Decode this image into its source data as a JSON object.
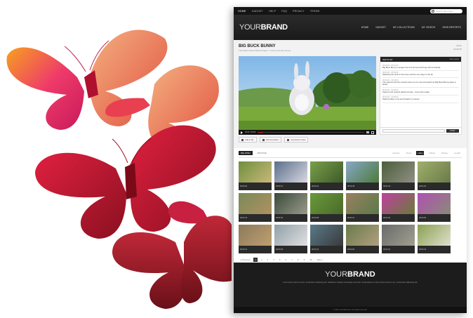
{
  "top_nav": {
    "items": [
      "HOME",
      "GADGET",
      "HELP",
      "FAQ",
      "PRIVACY",
      "TERMS"
    ],
    "search_placeholder": "Search video here"
  },
  "header": {
    "brand_main": "YOUR",
    "brand_bold": "BRAND",
    "nav": [
      "HOME",
      "GADGET",
      "MY COLLECTIONS",
      "MY VIDEOS",
      "VIEW REPORTS"
    ]
  },
  "video": {
    "title": "BIG BUCK BUNNY",
    "subtitle": "The Peach Open Movie Project · Funny and cute bunny",
    "meta_1": "Views",
    "meta_2": "00:09:56",
    "time": "00:00 / 09:56",
    "progress": 0.05
  },
  "shotlist": {
    "title": "SHOTLIST",
    "subtitle": "View sorted",
    "items": [
      {
        "time": "00:00:00 - 00:01:00",
        "text": "Big Buck Bunny emerges from his burrow and hugs with a butterfly"
      },
      {
        "time": "00:01:00 - 00:02:00",
        "text": "Watching the birds in the trees and the sun stays in the far"
      },
      {
        "time": "00:02:00 - 00:03:00",
        "text": "The squirrel and the rodents look out of a rock and watch as Big Buck Bunny plays a flower"
      },
      {
        "time": "00:03:00 - 00:04:00",
        "text": "Squirrel and rodents attack bunnies · they hold a plate"
      },
      {
        "time": "00:04:00 - 00:05:00",
        "text": "Squirrel takes a nut and breaks it in pieces"
      }
    ],
    "button": "POST"
  },
  "actions": [
    "Add to My",
    "Add annotation",
    "Download media"
  ],
  "gallery": {
    "tabs": [
      "RELATED",
      "BROWSE"
    ],
    "sorts": [
      "Newest",
      "Views",
      "Likes",
      "Oldest",
      "Rating",
      "Length"
    ],
    "active_sort": 2,
    "captions": [
      "00:00:00",
      "00:00:16",
      "00:00:32",
      "00:00:48",
      "00:01:04",
      "00:01:20",
      "00:01:36",
      "00:01:52",
      "00:02:08",
      "00:02:24",
      "00:02:40",
      "00:02:56",
      "00:03:12",
      "00:03:28",
      "00:03:44",
      "00:04:00",
      "00:04:16",
      "00:04:32"
    ],
    "tile_colors": [
      [
        "#6f8f3e",
        "#c9b77a"
      ],
      [
        "#5a6e8c",
        "#d8d8e0"
      ],
      [
        "#7aa04a",
        "#3d5a2a"
      ],
      [
        "#88a8c8",
        "#4d7a3a"
      ],
      [
        "#4c5e3a",
        "#8f8f84"
      ],
      [
        "#a0b06a",
        "#6a7a4a"
      ],
      [
        "#7a8a5a",
        "#b09060"
      ],
      [
        "#3a4a3a",
        "#9a9a8a"
      ],
      [
        "#6a9a3a",
        "#4a6a2a"
      ],
      [
        "#9a8060",
        "#5a7a4a"
      ],
      [
        "#c040a0",
        "#6a7a3a"
      ],
      [
        "#b050b0",
        "#8a8a7a"
      ],
      [
        "#8a7a5a",
        "#c0a070"
      ],
      [
        "#90a0a8",
        "#e0e0e0"
      ],
      [
        "#5a7a8a",
        "#3a3a3a"
      ],
      [
        "#6a7a4a",
        "#b0a080"
      ],
      [
        "#6a6a6a",
        "#a0a090"
      ],
      [
        "#8aa050",
        "#e0e0d0"
      ]
    ]
  },
  "pager": {
    "prev": "« Previous",
    "pages": [
      "1",
      "2",
      "3",
      "4",
      "5",
      "6",
      "7",
      "8",
      "9",
      "10"
    ],
    "active": 0,
    "next": "Next »"
  },
  "footer": {
    "brand_main": "YOUR",
    "brand_bold": "BRAND",
    "text": "Lorem ipsum dolor sit amet, consectetur adipiscing elit. Vestibulum tristique consequat commodo. Suspendisse vel nisl ornare ac lectus nec, consectetur adipiscing elit.",
    "copyright": "© 2011 Your Brand Inc. All rights reserved."
  }
}
